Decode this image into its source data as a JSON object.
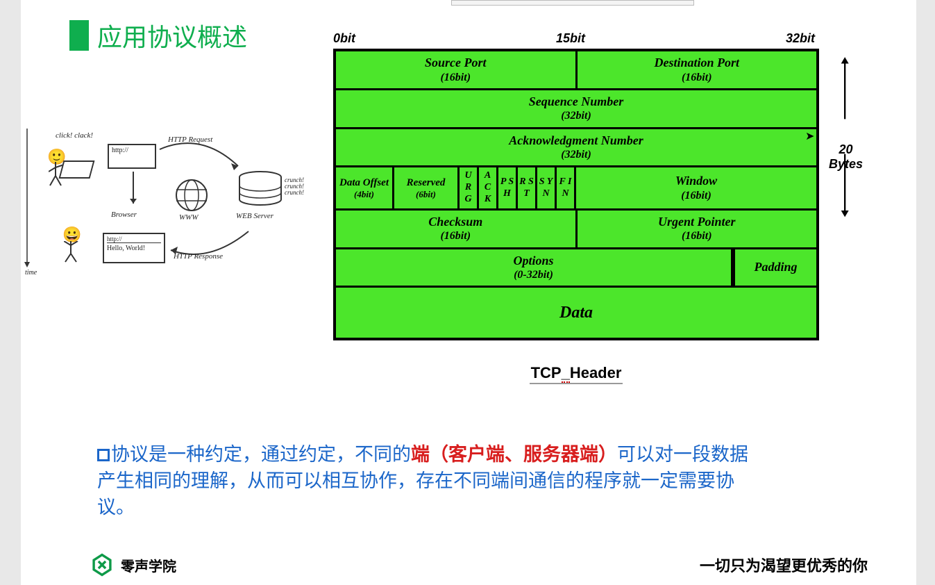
{
  "title": "应用协议概述",
  "bit_labels": {
    "left": "0bit",
    "mid": "15bit",
    "right": "32bit"
  },
  "tcp": {
    "row1": {
      "src": "Source Port",
      "src_sub": "(16bit)",
      "dst": "Destination Port",
      "dst_sub": "(16bit)"
    },
    "row2": {
      "seq": "Sequence Number",
      "seq_sub": "(32bit)"
    },
    "row3": {
      "ack": "Acknowledgment Number",
      "ack_sub": "(32bit)"
    },
    "row4": {
      "offset": "Data Offset",
      "offset_sub": "(4bit)",
      "reserved": "Reserved",
      "reserved_sub": "(6bit)",
      "flags": [
        {
          "t": "U R G"
        },
        {
          "t": "A C K"
        },
        {
          "t": "P S H"
        },
        {
          "t": "R S T"
        },
        {
          "t": "S Y N"
        },
        {
          "t": "F I N"
        }
      ],
      "window": "Window",
      "window_sub": "(16bit)"
    },
    "row5": {
      "chk": "Checksum",
      "chk_sub": "(16bit)",
      "urg": "Urgent Pointer",
      "urg_sub": "(16bit)"
    },
    "row6": {
      "opt": "Options",
      "opt_sub": "(0-32bit)",
      "pad": "Padding"
    },
    "row7": {
      "data": "Data"
    }
  },
  "bytes_label": "20 Bytes",
  "caption": "TCP_Header",
  "sketch": {
    "click": "click! clack!",
    "http": "http://",
    "req": "HTTP Request",
    "browser": "Browser",
    "www": "WWW",
    "crunch": "crunch! crunch! crunch!",
    "webserver": "WEB Server",
    "hello": "Hello, World!",
    "resp": "HTTP Response",
    "time": "time"
  },
  "desc": {
    "p1a": "协议是一种约定，通过约定，不同的",
    "p1b": "端（客户端、服务器端）",
    "p1c": "可以对一段数据产生相同的理解，从而可以相互协作，存在不同端间通信的程序就一定需要协议。"
  },
  "footer": {
    "left": "零声学院",
    "right": "一切只为渴望更优秀的你"
  }
}
